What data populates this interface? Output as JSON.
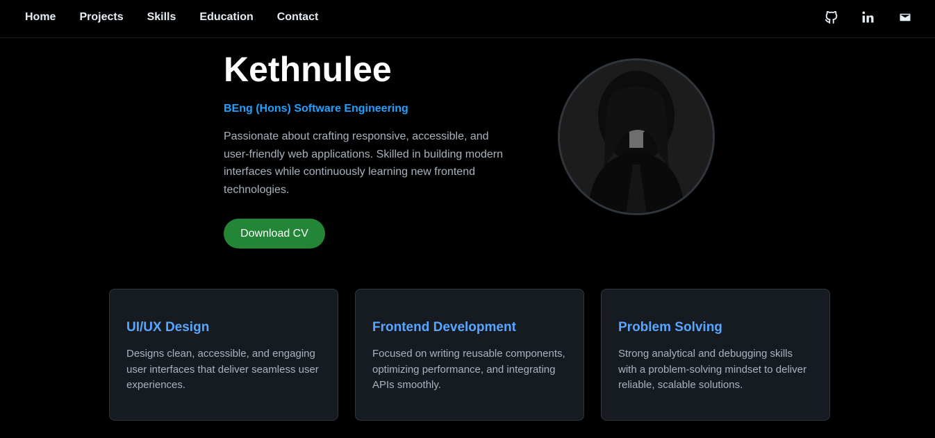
{
  "nav": {
    "links": [
      "Home",
      "Projects",
      "Skills",
      "Education",
      "Contact"
    ],
    "icons": [
      "github-icon",
      "linkedin-icon",
      "mail-icon"
    ]
  },
  "hero": {
    "name": "Kethnulee",
    "subtitle": "BEng (Hons) Software Engineering",
    "description": "Passionate about crafting responsive, accessible, and user-friendly web applications. Skilled in building modern interfaces while continuously learning new frontend technologies.",
    "cv_button": "Download CV"
  },
  "cards": [
    {
      "title": "UI/UX Design",
      "text": "Designs clean, accessible, and engaging user interfaces that deliver seamless user experiences."
    },
    {
      "title": "Frontend Development",
      "text": "Focused on writing reusable components, optimizing performance, and integrating APIs smoothly."
    },
    {
      "title": "Problem Solving",
      "text": "Strong analytical and debugging skills with a problem-solving mindset to deliver reliable, scalable solutions."
    }
  ],
  "colors": {
    "background": "#000000",
    "accent_blue": "#1fa2ff",
    "card_title": "#58a6ff",
    "button_green": "#238636",
    "card_bg": "#161b22"
  }
}
